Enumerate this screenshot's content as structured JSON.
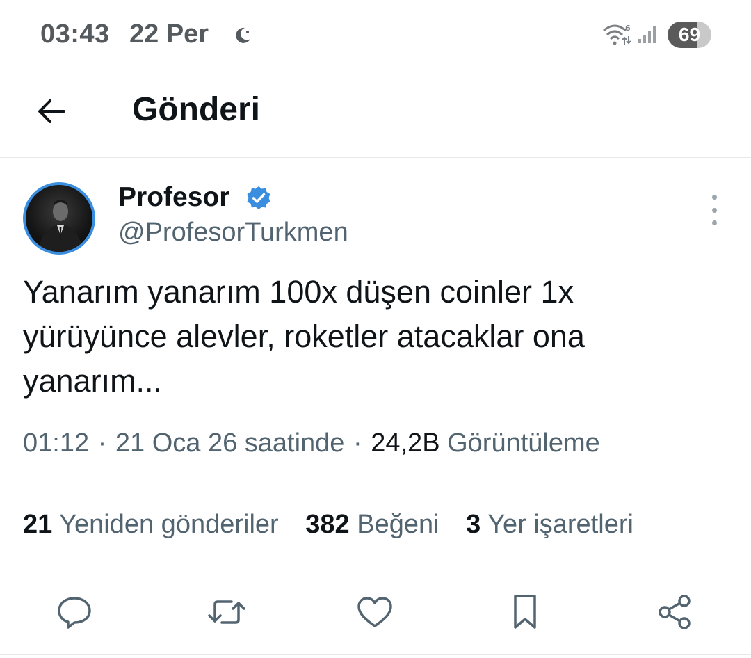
{
  "status_bar": {
    "time": "03:43",
    "date": "22 Per",
    "battery_level": "69",
    "battery_fraction": 0.69
  },
  "header": {
    "title": "Gönderi"
  },
  "post": {
    "display_name": "Profesor",
    "handle": "@ProfesorTurkmen",
    "text": "Yanarım yanarım 100x düşen coinler 1x yürüyünce alevler, roketler atacaklar ona yanarım...",
    "time": "01:12",
    "date": "21 Oca 26 saatinde",
    "views_count": "24,2B",
    "views_label": "Görüntüleme",
    "separator": "·"
  },
  "stats": {
    "reposts_count": "21",
    "reposts_label": "Yeniden gönderiler",
    "likes_count": "382",
    "likes_label": "Beğeni",
    "bookmarks_count": "3",
    "bookmarks_label": "Yer işaretleri"
  },
  "icons": {
    "accent": "#1d9bf0",
    "icon_color": "#536471",
    "verified_color": "#3a8ee0"
  }
}
